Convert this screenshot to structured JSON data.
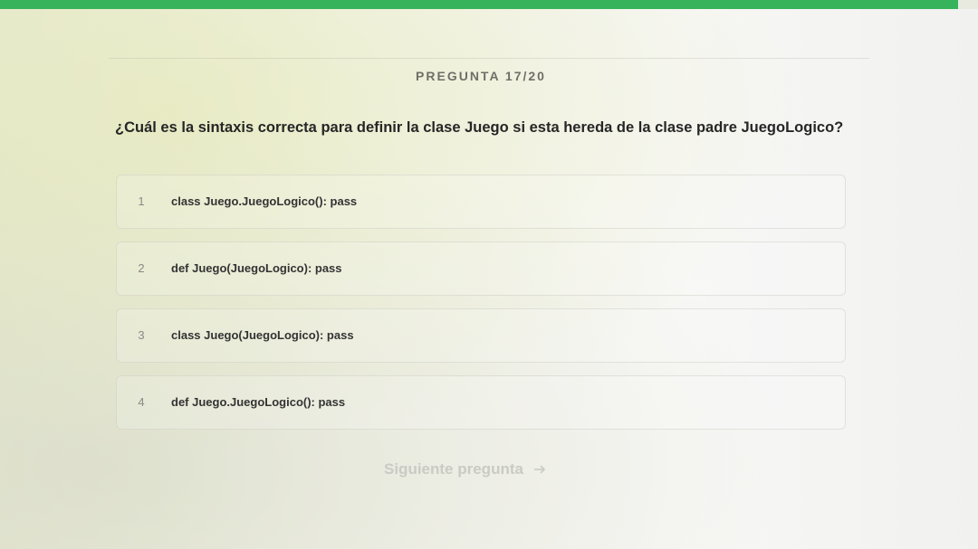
{
  "progress": {
    "fraction": 0.98,
    "color": "#37b45b"
  },
  "header": {
    "counter": "PREGUNTA 17/20"
  },
  "question": {
    "text": "¿Cuál es la sintaxis correcta para definir la clase Juego si esta hereda de la clase padre JuegoLogico?"
  },
  "options": [
    {
      "number": "1",
      "text": "class Juego.JuegoLogico(): pass"
    },
    {
      "number": "2",
      "text": "def Juego(JuegoLogico): pass"
    },
    {
      "number": "3",
      "text": "class Juego(JuegoLogico): pass"
    },
    {
      "number": "4",
      "text": "def Juego.JuegoLogico(): pass"
    }
  ],
  "next_button": {
    "label": "Siguiente pregunta",
    "icon": "arrow-right-icon"
  }
}
